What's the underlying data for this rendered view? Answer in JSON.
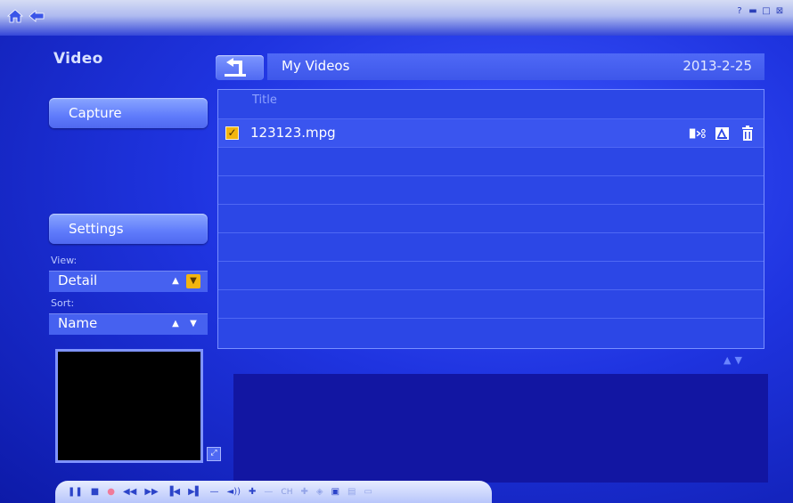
{
  "window": {
    "home_icon": "home-icon",
    "back_icon": "back-arrow-icon",
    "controls": [
      "help-icon",
      "minimize-icon",
      "restore-icon",
      "close-icon"
    ]
  },
  "sidebar": {
    "section_title": "Video",
    "capture_label": "Capture",
    "settings_label": "Settings",
    "view": {
      "label": "View:",
      "value": "Detail"
    },
    "sort": {
      "label": "Sort:",
      "value": "Name"
    }
  },
  "header": {
    "up_icon": "up-folder-icon",
    "folder_name": "My Videos",
    "date": "2013-2-25"
  },
  "file_list": {
    "column_title": "Title",
    "rows": [
      {
        "name": "123123.mpg",
        "checked": true,
        "actions": [
          "split-icon",
          "edit-icon",
          "trash-icon"
        ]
      }
    ]
  },
  "control_bar": {
    "channel_label": "CH",
    "icons": [
      "pause-icon",
      "stop-icon",
      "record-icon",
      "rewind-icon",
      "fast-forward-icon",
      "previous-icon",
      "next-icon",
      "volume-down-icon",
      "mute-icon",
      "volume-up-icon",
      "channel-down-icon",
      "channel-up-icon",
      "snapshot-icon",
      "camera-icon",
      "tv-icon",
      "aspect-icon"
    ]
  },
  "colors": {
    "accent": "#f3b50f",
    "background": "#1f34e0",
    "panel": "#2c47e6"
  }
}
